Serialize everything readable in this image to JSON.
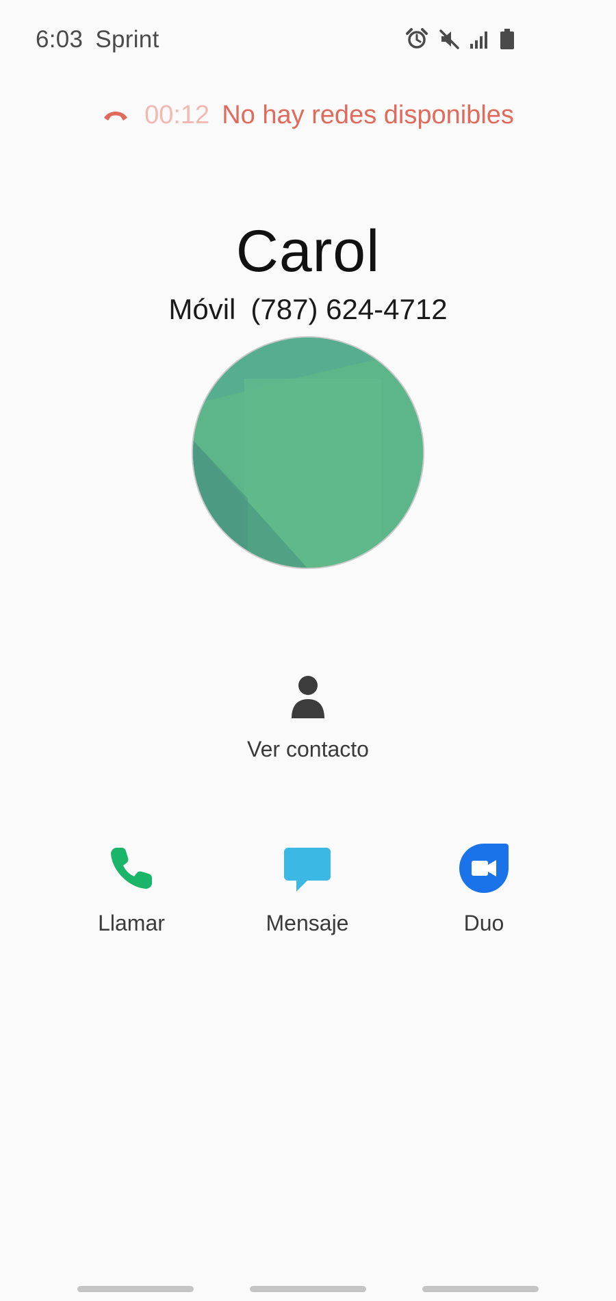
{
  "status_bar": {
    "time": "6:03",
    "carrier": "Sprint",
    "icons": [
      "alarm-icon",
      "mute-icon",
      "signal-icon",
      "battery-icon"
    ]
  },
  "call_status": {
    "timer": "00:12",
    "message": "No hay redes disponibles",
    "icon": "hangup-icon",
    "colors": {
      "timer": "#f2b8b2",
      "message": "#e06a5c"
    }
  },
  "contact": {
    "name": "Carol",
    "label": "Móvil",
    "number": "(787) 624-4712",
    "avatar_color": "#5db58a"
  },
  "view_contact": {
    "label": "Ver contacto",
    "icon": "person-icon"
  },
  "actions": [
    {
      "label": "Llamar",
      "icon": "phone-icon",
      "color": "#1bb56a"
    },
    {
      "label": "Mensaje",
      "icon": "message-icon",
      "color": "#3cb8e4"
    },
    {
      "label": "Duo",
      "icon": "duo-video-icon",
      "color": "#1a73e8"
    }
  ]
}
